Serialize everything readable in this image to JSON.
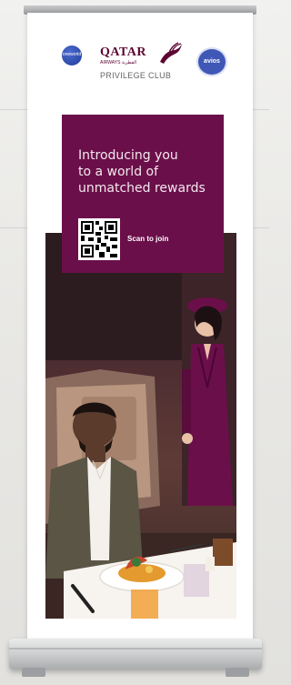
{
  "logos": {
    "oneworld": "oneworld",
    "airline_name": "QATAR",
    "airline_subtitle": "AIRWAYS القطرية",
    "program": "PRIVILEGE CLUB",
    "avios": "avios"
  },
  "promo": {
    "headline_lines": [
      "Introducing you",
      "to a world of",
      "unmatched rewards"
    ],
    "cta": "Scan to join"
  },
  "colors": {
    "brand_maroon": "#6b0f4a",
    "text_on_maroon": "#f3e8ee",
    "avios_blue": "#3f57b5"
  },
  "icons": [
    "oneworld-logo-icon",
    "oryx-icon",
    "avios-logo-icon",
    "qr-code-icon"
  ]
}
